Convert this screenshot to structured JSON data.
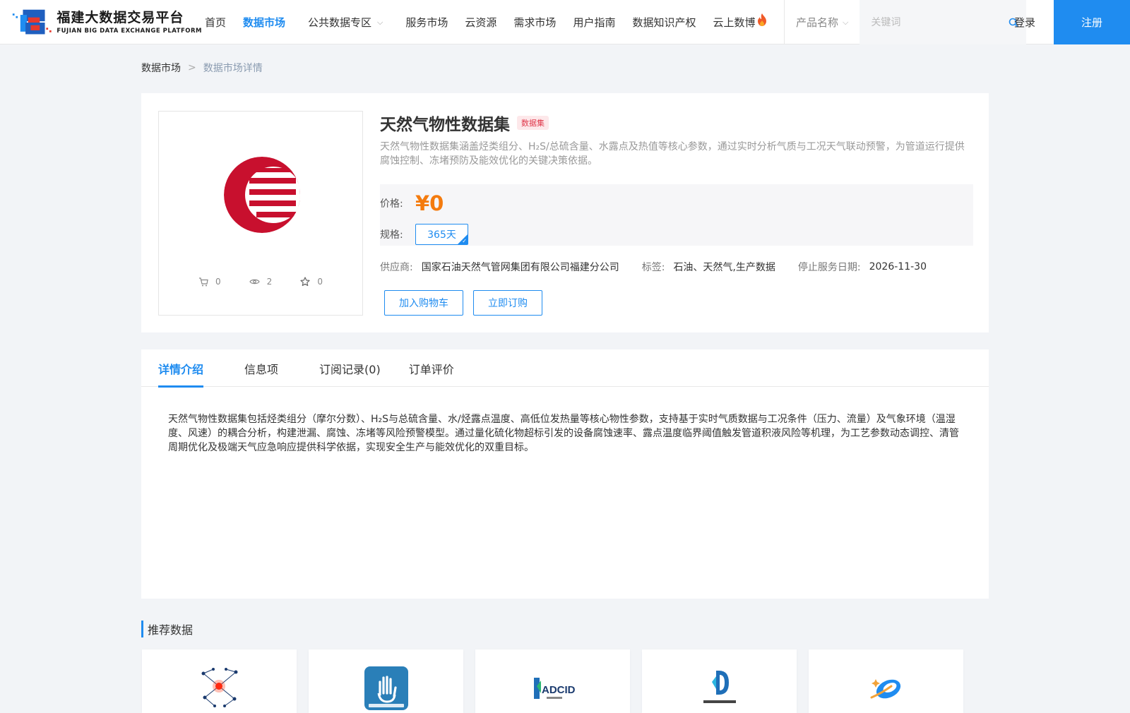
{
  "header": {
    "logo_cn": "福建大数据交易平台",
    "logo_en": "FUJIAN BIG DATA EXCHANGE PLATFORM",
    "nav": [
      {
        "label": "首页",
        "active": false
      },
      {
        "label": "数据市场",
        "active": true
      },
      {
        "label": "公共数据专区",
        "active": false,
        "dropdown": true
      },
      {
        "label": "服务市场",
        "active": false
      },
      {
        "label": "云资源",
        "active": false
      },
      {
        "label": "需求市场",
        "active": false
      },
      {
        "label": "用户指南",
        "active": false
      },
      {
        "label": "数据知识产权",
        "active": false
      },
      {
        "label": "云上数博",
        "active": false,
        "hot": true
      }
    ],
    "search_select": "产品名称",
    "search_placeholder": "关键词",
    "login": "登录",
    "register": "注册"
  },
  "breadcrumb": {
    "root": "数据市场",
    "separator": ">",
    "current": "数据市场详情"
  },
  "product": {
    "title": "天然气物性数据集",
    "type_badge": "数据集",
    "description": "天然气物性数据集涵盖烃类组分、H₂S/总硫含量、水露点及热值等核心参数，通过实时分析气质与工况天气联动预警，为管道运行提供腐蚀控制、冻堵预防及能效优化的关键决策依据。",
    "price_label": "价格:",
    "price": "¥0",
    "spec_label": "规格:",
    "spec": "365天",
    "supplier_label": "供应商:",
    "supplier": "国家石油天然气管网集团有限公司福建分公司",
    "tags_label": "标签:",
    "tags": "石油、天然气,生产数据",
    "end_date_label": "停止服务日期:",
    "end_date": "2026-11-30",
    "add_cart": "加入购物车",
    "subscribe": "立即订购",
    "stats": {
      "cart": "0",
      "views": "2",
      "favorites": "0"
    }
  },
  "tabs": [
    {
      "label": "详情介绍",
      "active": true
    },
    {
      "label": "信息项",
      "active": false
    },
    {
      "label": "订阅记录(0)",
      "active": false
    },
    {
      "label": "订单评价",
      "active": false
    }
  ],
  "detail_text": "天然气物性数据集包括烃类组分（摩尔分数）、H₂S与总硫含量、水/烃露点温度、高低位发热量等核心物性参数，支持基于实时气质数据与工况条件（压力、流量）及气象环境（温湿度、风速）的耦合分析，构建泄漏、腐蚀、冻堵等风险预警模型。通过量化硫化物超标引发的设备腐蚀速率、露点温度临界阈值触发管道积液风险等机理，为工艺参数动态调控、清管周期优化及极端天气应急响应提供科学依据，实现安全生产与能效优化的双重目标。",
  "recommend": {
    "title": "推荐数据",
    "items": [
      {
        "icon": "network-graph-icon"
      },
      {
        "icon": "hand-sign-app-icon"
      },
      {
        "icon": "adcid-logo-icon"
      },
      {
        "icon": "quanzhou-data-logo-icon"
      },
      {
        "icon": "satellite-logo-icon"
      }
    ]
  },
  "colors": {
    "accent": "#1f8cf0",
    "price": "#f47b0e",
    "badge_bg": "#fde8ea",
    "badge_text": "#e0394c",
    "brand_red": "#c8102e"
  }
}
